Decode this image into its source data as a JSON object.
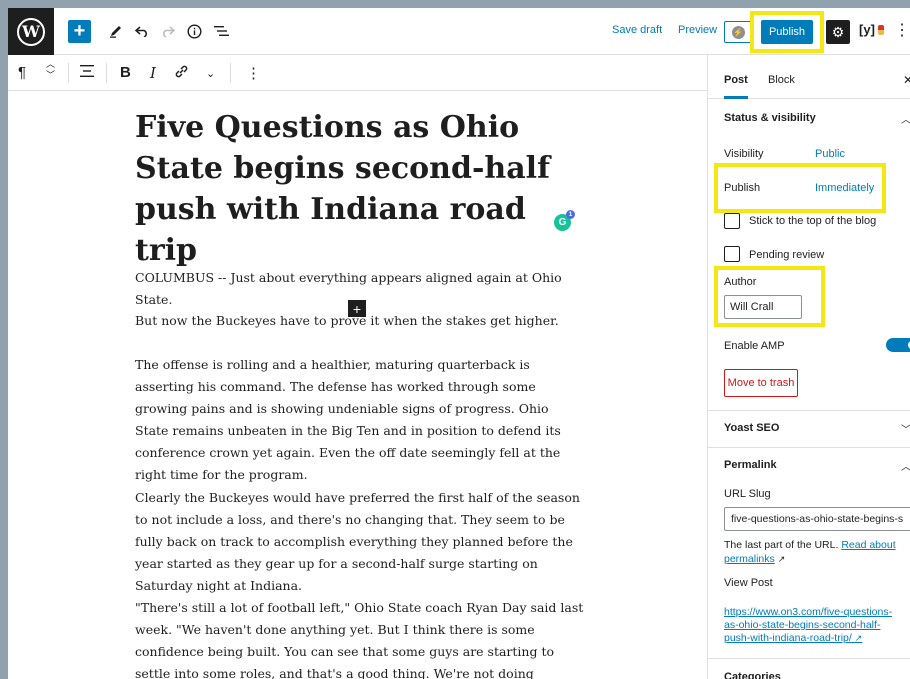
{
  "toolbar": {
    "wp_logo": "W",
    "add_block_icon": "plus-icon",
    "tools_icon": "pencil-icon",
    "undo_icon": "undo-icon",
    "redo_icon": "redo-icon",
    "details_icon": "info-icon",
    "outline_icon": "list-view-icon",
    "save_draft": "Save draft",
    "preview": "Preview",
    "publish": "Publish",
    "settings_icon": "gear-icon",
    "yoast_label": "y",
    "more_icon": "vertical-ellipsis-icon"
  },
  "block_toolbar": {
    "paragraph_icon": "¶",
    "align_icon": "align-left-icon",
    "bold": "B",
    "italic": "I",
    "link_icon": "link-icon",
    "more_rich_text_icon": "chevron-down-icon",
    "options_icon": "vertical-ellipsis-icon"
  },
  "editor": {
    "title": "Five Questions as Ohio State begins second-half push with Indiana road trip",
    "paragraphs": [
      "COLUMBUS -- Just about everything appears aligned again at Ohio State.",
      "But now the Buckeyes have to prove it when the stakes get higher.",
      "The offense is rolling and a healthier, maturing quarterback is asserting his command. The defense has worked through some growing pains and is showing undeniable signs of progress. Ohio State remains unbeaten in the Big Ten and in position to defend its conference crown yet again. Even the off date seemingly fell at the right time for the program.",
      "Clearly the Buckeyes would have preferred the first half of the season to not include a loss, and there's no changing that. They seem to be fully back on track to accomplish everything they planned before the year started as they gear up for a second-half surge starting on Saturday night at Indiana.",
      "\"There's still a lot of football left,\" Ohio State coach Ryan Day said last week. \"We haven't done anything yet. But I think there is some confidence being built. You can see that some guys are starting to settle into some roles, and that's a good thing. We're not doing everything for the first time. I think"
    ],
    "grammarly_badge": "1"
  },
  "sidebar": {
    "tabs": [
      "Post",
      "Block"
    ],
    "status_visibility": {
      "title": "Status & visibility",
      "visibility_label": "Visibility",
      "visibility_value": "Public",
      "publish_label": "Publish",
      "publish_value": "Immediately",
      "sticky_label": "Stick to the top of the blog",
      "pending_label": "Pending review",
      "author_label": "Author",
      "author_value": "Will Crall",
      "amp_label": "Enable AMP",
      "trash_label": "Move to trash"
    },
    "yoast_title": "Yoast SEO",
    "permalink": {
      "title": "Permalink",
      "slug_label": "URL Slug",
      "slug_value": "five-questions-as-ohio-state-begins-s",
      "help_text": "The last part of the URL.",
      "help_link": "Read about permalinks",
      "view_label": "View Post",
      "view_url": "https://www.on3.com/five-questions-as-ohio-state-begins-second-half-push-with-indiana-road-trip/"
    },
    "categories_title": "Categories"
  },
  "colors": {
    "accent": "#007cba",
    "highlight": "#f5e614",
    "danger": "#cc1818",
    "dark": "#1e1e1e"
  }
}
